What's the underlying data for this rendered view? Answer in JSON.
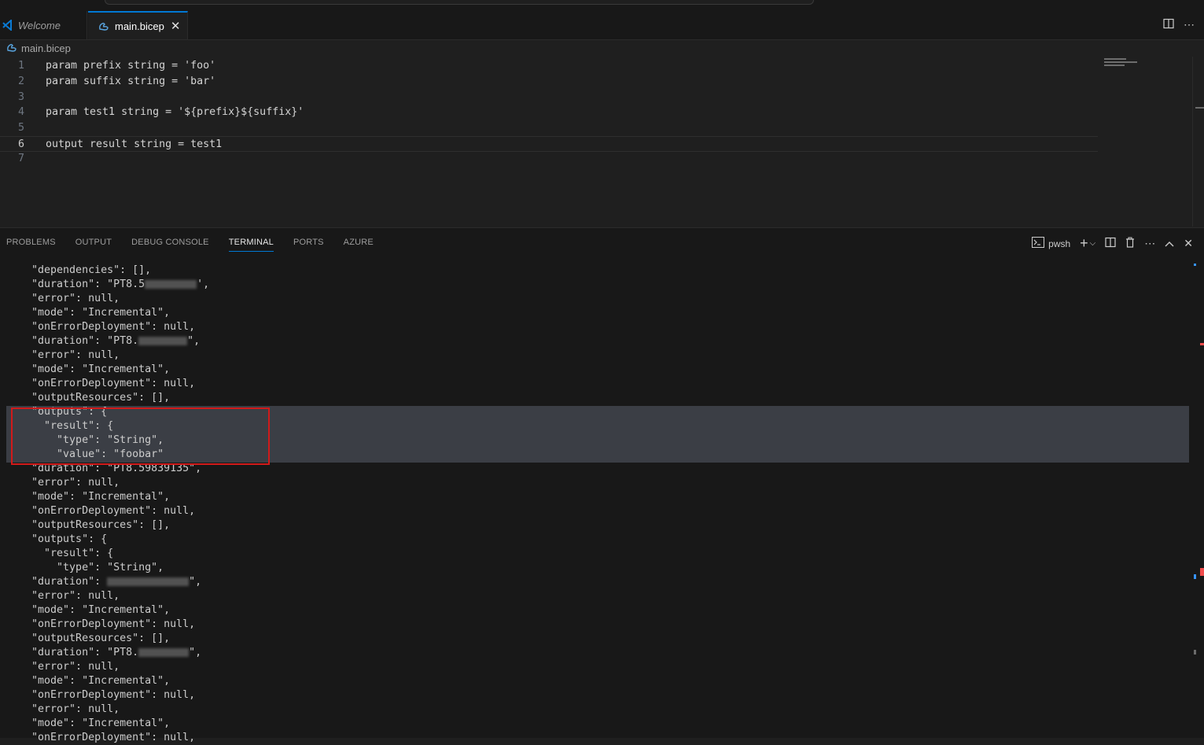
{
  "tabs": [
    {
      "label": "Welcome"
    },
    {
      "label": "main.bicep",
      "close": "✕"
    }
  ],
  "breadcrumb": "main.bicep",
  "editor": {
    "lines": [
      {
        "n": "1",
        "code": "param prefix string = 'foo'"
      },
      {
        "n": "2",
        "code": "param suffix string = 'bar'"
      },
      {
        "n": "3",
        "code": ""
      },
      {
        "n": "4",
        "code": "param test1 string = '${prefix}${suffix}'"
      },
      {
        "n": "5",
        "code": ""
      },
      {
        "n": "6",
        "code": "output result string = test1"
      },
      {
        "n": "7",
        "code": ""
      }
    ]
  },
  "panel": {
    "tabs": [
      "PROBLEMS",
      "OUTPUT",
      "DEBUG CONSOLE",
      "TERMINAL",
      "PORTS",
      "AZURE"
    ],
    "active_tab": "TERMINAL",
    "shell": "pwsh"
  },
  "terminal": {
    "lines": [
      "    \"dependencies\": [],",
      "    \"duration\": \"PT8.5",
      "    \"error\": null,",
      "    \"mode\": \"Incremental\",",
      "    \"onErrorDeployment\": null,",
      "    \"duration\": \"PT8.",
      "    \"error\": null,",
      "    \"mode\": \"Incremental\",",
      "    \"onErrorDeployment\": null,",
      "    \"outputResources\": [],",
      "    \"outputs\": {",
      "      \"result\": {",
      "        \"type\": \"String\",",
      "        \"value\": \"foobar\"",
      "    \"duration\": \"PT8.59839135\",",
      "    \"error\": null,",
      "    \"mode\": \"Incremental\",",
      "    \"onErrorDeployment\": null,",
      "    \"outputResources\": [],",
      "    \"outputs\": {",
      "      \"result\": {",
      "        \"type\": \"String\",",
      "    \"duration\": ",
      "    \"error\": null,",
      "    \"mode\": \"Incremental\",",
      "    \"onErrorDeployment\": null,",
      "    \"outputResources\": [],",
      "    \"duration\": \"PT8.",
      "    \"error\": null,",
      "    \"mode\": \"Incremental\",",
      "    \"onErrorDeployment\": null,",
      "    \"error\": null,",
      "    \"mode\": \"Incremental\",",
      "    \"onErrorDeployment\": null,"
    ],
    "line_suffixes": {
      "1": "',",
      "5": "\",",
      "22": "\",",
      "27": "\","
    }
  }
}
